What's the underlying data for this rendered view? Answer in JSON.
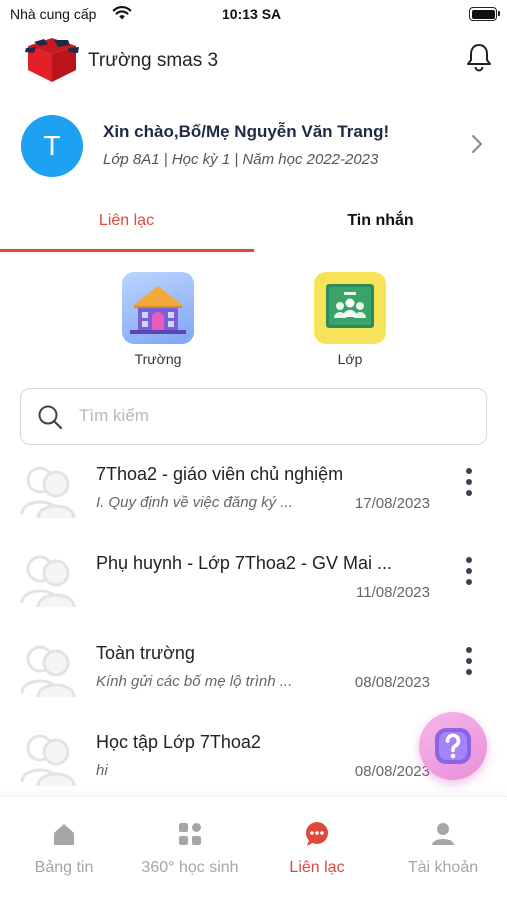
{
  "status_bar": {
    "carrier": "Nhà cung cấp",
    "time": "10:13 SA"
  },
  "header": {
    "school_name": "Trường smas 3"
  },
  "greeting": {
    "avatar_letter": "T",
    "title": "Xin chào,Bố/Mẹ Nguyễn Văn Trang!",
    "subtitle": "Lớp 8A1 | Học kỳ 1 | Năm học 2022-2023"
  },
  "tabs": [
    {
      "label": "Liên lạc",
      "active": true
    },
    {
      "label": "Tin nhắn",
      "active": false
    }
  ],
  "categories": [
    {
      "label": "Trường",
      "icon": "school-building-icon"
    },
    {
      "label": "Lớp",
      "icon": "classroom-board-icon"
    }
  ],
  "search": {
    "placeholder": "Tìm kiếm"
  },
  "conversations": [
    {
      "title": "7Thoa2 - giáo viên chủ nghiệm",
      "preview": "I. Quy định về việc đăng ký ...",
      "date": "17/08/2023",
      "has_menu": true
    },
    {
      "title": "Phụ huynh - Lớp 7Thoa2 - GV Mai ...",
      "preview": "",
      "date": "11/08/2023",
      "has_menu": true
    },
    {
      "title": "Toàn trường",
      "preview": "Kính gửi các bố mẹ lộ trình ...",
      "date": "08/08/2023",
      "has_menu": true
    },
    {
      "title": "Học tập Lớp 7Thoa2",
      "preview": "hi",
      "date": "08/08/2023",
      "has_menu": false
    }
  ],
  "bottom_nav": [
    {
      "label": "Bảng tin",
      "icon": "home-icon",
      "active": false
    },
    {
      "label": "360° học sinh",
      "icon": "grid-icon",
      "active": false
    },
    {
      "label": "Liên lạc",
      "icon": "chat-bubble-icon",
      "active": true
    },
    {
      "label": "Tài khoản",
      "icon": "user-icon",
      "active": false
    }
  ],
  "colors": {
    "accent": "#e0483c",
    "avatar": "#1da1f2",
    "help_button": "#e88fd9"
  }
}
